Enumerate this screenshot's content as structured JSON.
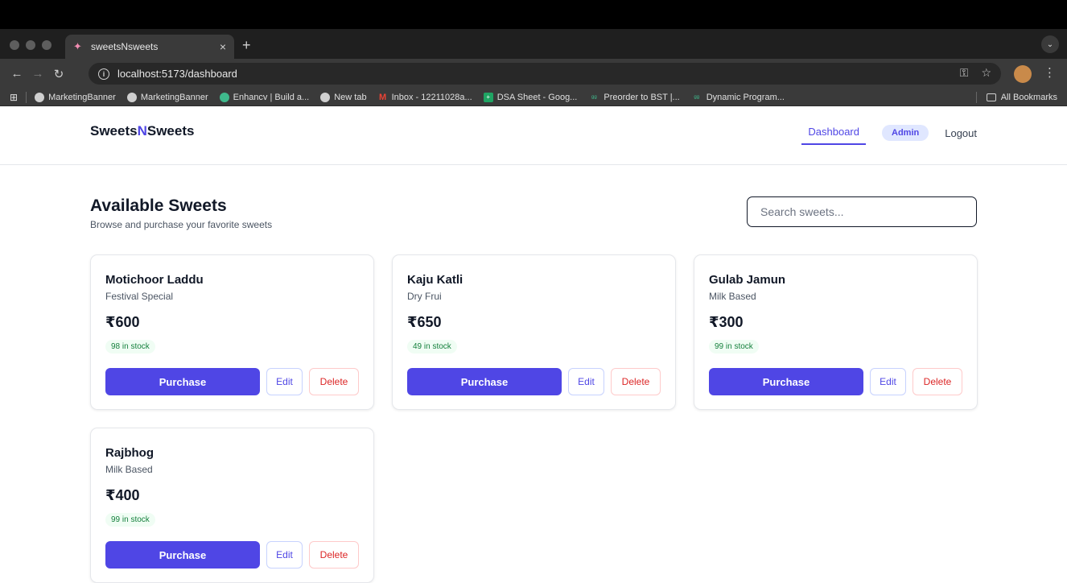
{
  "browser": {
    "tab_title": "sweetsNsweets",
    "tab_close": "×",
    "new_tab": "+",
    "url": "localhost:5173/dashboard",
    "bookmarks": [
      {
        "label": "MarketingBanner",
        "icon": "globe-icon"
      },
      {
        "label": "MarketingBanner",
        "icon": "globe-icon"
      },
      {
        "label": "Enhancv | Build a...",
        "icon": "enhancv-icon"
      },
      {
        "label": "New tab",
        "icon": "globe-icon"
      },
      {
        "label": "Inbox - 12211028a...",
        "icon": "gmail-icon"
      },
      {
        "label": "DSA Sheet - Goog...",
        "icon": "sheets-icon"
      },
      {
        "label": "Preorder to BST |...",
        "icon": "gfg-icon"
      },
      {
        "label": "Dynamic Program...",
        "icon": "gfg-icon"
      }
    ],
    "all_bookmarks": "All Bookmarks"
  },
  "app": {
    "brand_part1": "Sweets",
    "brand_part2": "N",
    "brand_part3": "Sweets",
    "nav": {
      "dashboard": "Dashboard",
      "admin": "Admin",
      "logout": "Logout"
    },
    "page_title": "Available Sweets",
    "page_subtitle": "Browse and purchase your favorite sweets",
    "search_placeholder": "Search sweets...",
    "accent_color": "#4f46e5"
  },
  "sweets": [
    {
      "name": "Motichoor Laddu",
      "category": "Festival Special",
      "price": "₹600",
      "stock": "98 in stock",
      "purchase": "Purchase",
      "edit": "Edit",
      "delete": "Delete"
    },
    {
      "name": "Kaju Katli",
      "category": "Dry Frui",
      "price": "₹650",
      "stock": "49 in stock",
      "purchase": "Purchase",
      "edit": "Edit",
      "delete": "Delete"
    },
    {
      "name": "Gulab Jamun",
      "category": "Milk Based",
      "price": "₹300",
      "stock": "99 in stock",
      "purchase": "Purchase",
      "edit": "Edit",
      "delete": "Delete"
    },
    {
      "name": "Rajbhog",
      "category": "Milk Based",
      "price": "₹400",
      "stock": "99 in stock",
      "purchase": "Purchase",
      "edit": "Edit",
      "delete": "Delete"
    }
  ]
}
